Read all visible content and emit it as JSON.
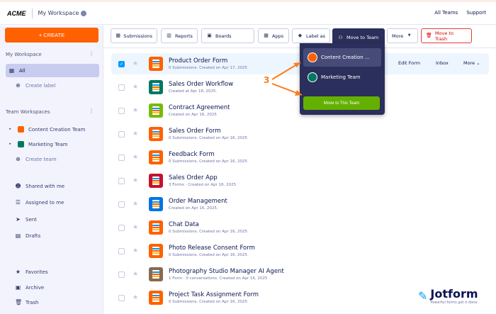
{
  "header": {
    "logo": "ACME",
    "workspace": "My Workspace",
    "links": [
      "All Teams",
      "Support"
    ]
  },
  "sidebar": {
    "create": "+ CREATE",
    "my_workspace": "My Workspace",
    "all": "All",
    "create_label": "Create label",
    "team_workspaces": "Team Workspaces",
    "teams": [
      "Content Creation Team",
      "Marketing Team"
    ],
    "create_team": "Create team",
    "nav": [
      "Shared with me",
      "Assigned to me",
      "Sent",
      "Drafts"
    ],
    "bottom": [
      "Favorites",
      "Archive",
      "Trash"
    ]
  },
  "toolbar": {
    "submissions": "Submissions",
    "reports": "Reports",
    "boards": "Boards",
    "apps": "Apps",
    "label_as": "Label as",
    "move_to_team": "Move to Team",
    "more": "More",
    "move_to_trash": "Move to Trash"
  },
  "dropdown": {
    "items": [
      "Content Creation ...",
      "Marketing Team"
    ],
    "button": "Move to This Team"
  },
  "row_actions": {
    "edit": "Edit Form",
    "inbox": "Inbox",
    "more": "More"
  },
  "forms": [
    {
      "name": "Product Order Form",
      "meta": "0 Submissions. Created on Apr 17, 2025",
      "color": "#ff6100",
      "selected": true
    },
    {
      "name": "Sales Order Workflow",
      "meta": "Created at Apr 16, 2025.",
      "color": "#007862"
    },
    {
      "name": "Contract Agreement",
      "meta": "Created on Apr 16, 2025",
      "color": "#78bb07"
    },
    {
      "name": "Sales Order Form",
      "meta": "0 Submissions. Created on Apr 16, 2025",
      "color": "#ff6100"
    },
    {
      "name": "Feedback Form",
      "meta": "0 Submissions. Created on Apr 16, 2025",
      "color": "#ff6100"
    },
    {
      "name": "Sales Order App",
      "meta": "3 Forms · Created on Apr 16, 2025",
      "color": "#c8102e"
    },
    {
      "name": "Order Management",
      "meta": "Created on Apr 16, 2025.",
      "color": "#0075e3"
    },
    {
      "name": "Chat Data",
      "meta": "0 Submissions. Created on Apr 16, 2025",
      "color": "#ff6100"
    },
    {
      "name": "Photo Release Consent Form",
      "meta": "0 Submissions. Created on Apr 16, 2025",
      "color": "#ff6100"
    },
    {
      "name": "Photography Studio Manager AI Agent",
      "meta": "1 Form · 0 conversations. Created on Apr 16, 2025",
      "color": "#8a6a50"
    },
    {
      "name": "Project Task Assignment Form",
      "meta": "0 Submissions. Created on Apr 16, 2025",
      "color": "#ff6100"
    }
  ],
  "annotation": "3",
  "watermark": {
    "name": "Jotform",
    "tagline": "Powerful forms get it done."
  }
}
